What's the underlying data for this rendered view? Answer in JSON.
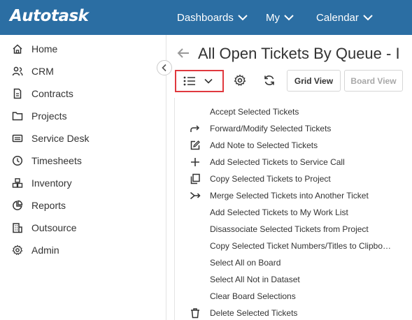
{
  "app": {
    "logo": "Autotask"
  },
  "topnav": [
    {
      "label": "Dashboards"
    },
    {
      "label": "My"
    },
    {
      "label": "Calendar"
    }
  ],
  "sidebar": {
    "items": [
      {
        "label": "Home",
        "icon": "home-icon"
      },
      {
        "label": "CRM",
        "icon": "users-icon"
      },
      {
        "label": "Contracts",
        "icon": "contract-icon"
      },
      {
        "label": "Projects",
        "icon": "folder-icon"
      },
      {
        "label": "Service Desk",
        "icon": "service-desk-icon"
      },
      {
        "label": "Timesheets",
        "icon": "clock-icon"
      },
      {
        "label": "Inventory",
        "icon": "inventory-icon"
      },
      {
        "label": "Reports",
        "icon": "pie-chart-icon"
      },
      {
        "label": "Outsource",
        "icon": "building-icon"
      },
      {
        "label": "Admin",
        "icon": "gear-icon"
      }
    ]
  },
  "main": {
    "title": "All Open Tickets By Queue - I",
    "toolbar": {
      "grid_view": "Grid View",
      "board_view": "Board View"
    },
    "menu_items": [
      {
        "label": "Accept Selected Tickets",
        "icon": ""
      },
      {
        "label": "Forward/Modify Selected Tickets",
        "icon": "forward-icon"
      },
      {
        "label": "Add Note to Selected Tickets",
        "icon": "edit-icon"
      },
      {
        "label": "Add Selected Tickets to Service Call",
        "icon": "plus-icon"
      },
      {
        "label": "Copy Selected Tickets to Project",
        "icon": "copy-icon"
      },
      {
        "label": "Merge Selected Tickets into Another Ticket",
        "icon": "merge-icon"
      },
      {
        "label": "Add Selected Tickets to My Work List",
        "icon": ""
      },
      {
        "label": "Disassociate Selected Tickets from Project",
        "icon": ""
      },
      {
        "label": "Copy Selected Ticket Numbers/Titles to Clipbo…",
        "icon": ""
      },
      {
        "label": "Select All on Board",
        "icon": ""
      },
      {
        "label": "Select All Not in Dataset",
        "icon": ""
      },
      {
        "label": "Clear Board Selections",
        "icon": ""
      },
      {
        "label": "Delete Selected Tickets",
        "icon": "trash-icon"
      }
    ]
  },
  "colors": {
    "topbar": "#2b6ea3",
    "highlight": "#e0393e"
  }
}
